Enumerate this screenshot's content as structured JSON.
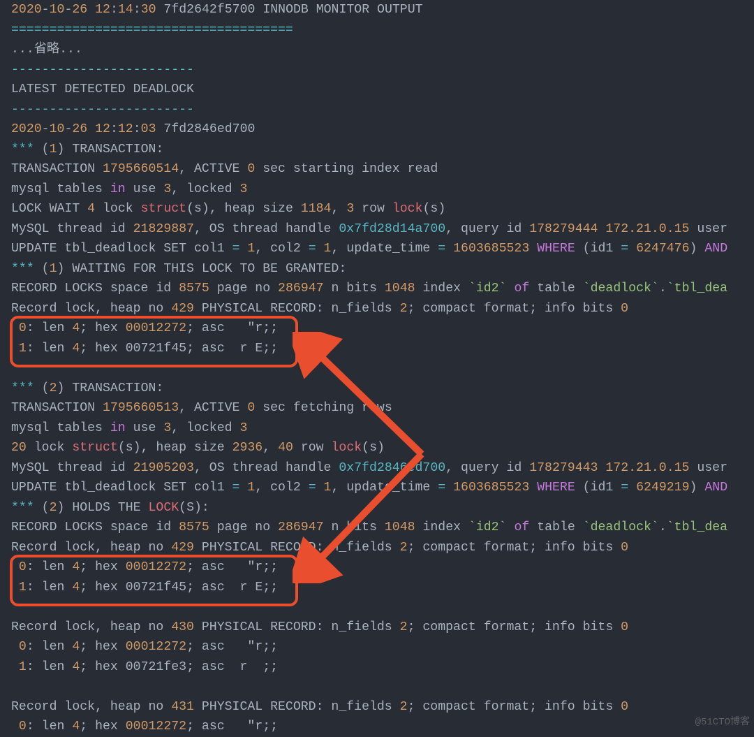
{
  "l00": "2020-10-26 12:14:30 7fd2642f5700 INNODB MONITOR OUTPUT",
  "l01": "=====================================",
  "l02": "...省略...",
  "l03": "------------------------",
  "l04": "LATEST DETECTED DEADLOCK",
  "l05": "------------------------",
  "l06": "2020-10-26 12:12:03 7fd2846ed700",
  "l07": "*** (1) TRANSACTION:",
  "l08": "TRANSACTION 1795660514, ACTIVE 0 sec starting index read",
  "l09": "mysql tables in use 3, locked 3",
  "l10": "LOCK WAIT 4 lock struct(s), heap size 1184, 3 row lock(s)",
  "l11": "MySQL thread id 21829887, OS thread handle 0x7fd28d14a700, query id 178279444 172.21.0.15 user",
  "l12": "UPDATE tbl_deadlock SET col1 = 1, col2 = 1, update_time = 1603685523 WHERE (id1 = 6247476) AND",
  "l13": "*** (1) WAITING FOR THIS LOCK TO BE GRANTED:",
  "l14": "RECORD LOCKS space id 8575 page no 286947 n bits 1048 index `id2` of table `deadlock`.`tbl_dea",
  "l15": "Record lock, heap no 429 PHYSICAL RECORD: n_fields 2; compact format; info bits 0",
  "l16": " 0: len 4; hex 00012272; asc   \"r;;",
  "l17": " 1: len 4; hex 00721f45; asc  r E;;",
  "l18": "",
  "l19": "*** (2) TRANSACTION:",
  "l20": "TRANSACTION 1795660513, ACTIVE 0 sec fetching rows",
  "l21": "mysql tables in use 3, locked 3",
  "l22": "20 lock struct(s), heap size 2936, 40 row lock(s)",
  "l23": "MySQL thread id 21905203, OS thread handle 0x7fd2846ed700, query id 178279443 172.21.0.15 user",
  "l24": "UPDATE tbl_deadlock SET col1 = 1, col2 = 1, update_time = 1603685523 WHERE (id1 = 6249219) AND",
  "l25": "*** (2) HOLDS THE LOCK(S):",
  "l26": "RECORD LOCKS space id 8575 page no 286947 n bits 1048 index `id2` of table `deadlock`.`tbl_dea",
  "l27": "Record lock, heap no 429 PHYSICAL RECORD: n_fields 2; compact format; info bits 0",
  "l28": " 0: len 4; hex 00012272; asc   \"r;;",
  "l29": " 1: len 4; hex 00721f45; asc  r E;;",
  "l30": "",
  "l31": "Record lock, heap no 430 PHYSICAL RECORD: n_fields 2; compact format; info bits 0",
  "l32": " 0: len 4; hex 00012272; asc   \"r;;",
  "l33": " 1: len 4; hex 00721fe3; asc  r  ;;",
  "l34": "",
  "l35": "Record lock, heap no 431 PHYSICAL RECORD: n_fields 2; compact format; info bits 0",
  "l36": " 0: len 4; hex 00012272; asc   \"r;;",
  "watermark": "@51CTO博客",
  "tokens": {
    "date1": {
      "yy": "2020",
      "mm": "10",
      "dd": "26",
      "hh": "12",
      "mi": "14",
      "ss": "30",
      "hex": "7fd2642f5700"
    },
    "date2": {
      "yy": "2020",
      "mm": "10",
      "dd": "26",
      "hh": "12",
      "mi": "12",
      "ss": "03",
      "hex": "7fd2846ed700"
    },
    "trans1": "1795660514",
    "trans2": "1795660513",
    "pageno": "286947",
    "spaceid": "8575",
    "nbits": "1048",
    "heap429": "429",
    "heap430": "430",
    "heap431": "431",
    "thid1": "21829887",
    "thid2": "21905203",
    "hdl1": "0x7fd28d14a700",
    "hdl2": "0x7fd2846ed700",
    "qid1": "178279444",
    "qid2": "178279443",
    "ip": "172.21.0.15",
    "uts": "1603685523",
    "id1a": "6247476",
    "id1b": "6249219",
    "heap": "1184",
    "heap2": "2936",
    "rows2": "40",
    "twenty": "20",
    "nf": "2",
    "zero": "0",
    "one": "1",
    "three": "3",
    "four": "4",
    "tbl": "`tbl_dea",
    "db": "`deadlock`",
    "id2": "`id2`",
    "hex_a": "00012272",
    "hex_b": "00721f45",
    "hex_c": "00721fe3"
  }
}
